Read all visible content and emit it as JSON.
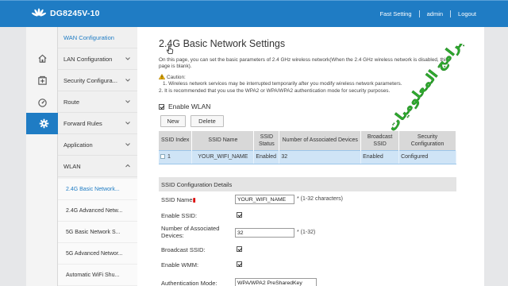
{
  "header": {
    "model": "DG8245V-10",
    "fast_setting": "Fast Setting",
    "user": "admin",
    "logout": "Logout"
  },
  "rail": {
    "icons": [
      "home-icon",
      "add-box-icon",
      "dashboard-icon",
      "gear-icon"
    ],
    "active": "gear-icon"
  },
  "menu": {
    "items": [
      "WAN Configuration",
      "LAN Configuration",
      "Security Configura...",
      "Route",
      "Forward Rules",
      "Application",
      "WLAN"
    ],
    "sub_items": [
      "2.4G Basic Network...",
      "2.4G Advanced Netw...",
      "5G Basic Network S...",
      "5G Advanced Networ...",
      "Automatic WiFi Shu..."
    ]
  },
  "main": {
    "title": "2.4G Basic Network Settings",
    "intro": "On this page, you can set the basic parameters of 2.4 GHz wireless network(When the 2.4 GHz wireless network is disabled, this page is blank).",
    "caution_label": "Caution:",
    "caution_1": "1. Wireless network services may be interrupted temporarily after you modify wireless network parameters.",
    "caution_2": "2. It is recommended that you use the WPA2 or WPA/WPA2 authentication mode for security purposes.",
    "enable_wlan": "Enable WLAN",
    "new_button": "New",
    "delete_button": "Delete"
  },
  "table": {
    "headers": [
      "SSID Index",
      "SSID Name",
      "SSID Status",
      "Number of Associated Devices",
      "Broadcast SSID",
      "Security Configuration"
    ],
    "rows": [
      {
        "index": "1",
        "name": "YOUR_WIFI_NAME",
        "status": "Enabled",
        "devices": "32",
        "broadcast": "Enabled",
        "security": "Configured"
      }
    ]
  },
  "config": {
    "section_title": "SSID Configuration Details",
    "ssid_name_label": "SSID Name",
    "ssid_name_value": "YOUR_WIFI_NAME",
    "ssid_name_hint": "* (1-32 characters)",
    "enable_ssid_label": "Enable SSID:",
    "assoc_label_1": "Number of Associated",
    "assoc_label_2": "Devices:",
    "assoc_value": "32",
    "assoc_hint": "* (1-32)",
    "broadcast_label": "Broadcast SSID:",
    "wmm_label": "Enable WMM:",
    "auth_label": "Authentication Mode:",
    "auth_value": "WPA/WPA2 PreSharedKey"
  },
  "watermark": {
    "text": "برامج المعلوميات"
  },
  "colors": {
    "brand_blue": "#1f7cc4",
    "row_selected": "#cfe4f6",
    "watermark_green": "#2ea82e"
  }
}
